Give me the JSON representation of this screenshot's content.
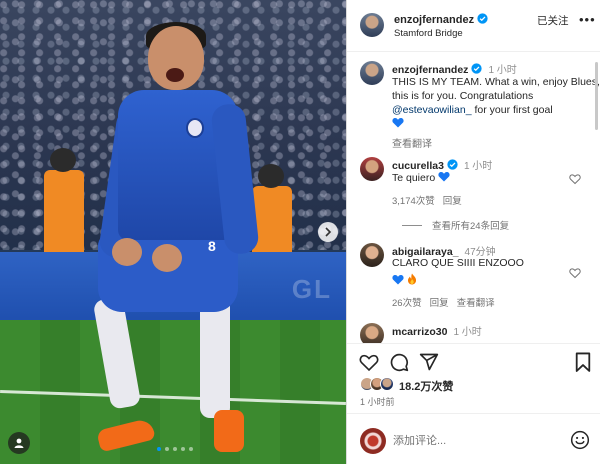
{
  "post": {
    "author": "enzojfernandez",
    "location": "Stamford Bridge",
    "follow_status": "已关注",
    "more_label": "•••",
    "jersey_number": "8",
    "caption": {
      "time": "1 小时",
      "text_before": "THIS IS MY TEAM. What a win, enjoy Blues, this is for you. Congratulations ",
      "mention": "@estevaowilian_",
      "text_after": " for your first goal",
      "see_translation": "查看翻译"
    },
    "likes": "18.2万次赞",
    "posted_ago": "1 小时前",
    "add_comment_placeholder": "添加评论..."
  },
  "comments": [
    {
      "user": "cucurella3",
      "time": "1 小时",
      "text": "Te quiero",
      "likes": "3,174次赞",
      "reply": "回复",
      "view_replies": "查看所有24条回复"
    },
    {
      "user": "abigailaraya_",
      "time": "47分钟",
      "text": "CLARO QUE SIIII ENZOOO",
      "likes": "26次赞",
      "reply": "回复",
      "see_translation": "查看翻译"
    },
    {
      "user": "mcarrizo30",
      "time": "1 小时"
    }
  ],
  "icons": {
    "like": "heart-icon",
    "comment": "comment-icon",
    "share": "share-icon",
    "save": "bookmark-icon",
    "emoji": "smiley-icon",
    "verified": "verified-badge-icon",
    "next": "chevron-right-icon",
    "tags": "user-tag-icon"
  },
  "colors": {
    "verified": "#0095f6",
    "mention": "#00376b",
    "blue_heart": "#1877f2",
    "muted": "#737373",
    "divider": "#dbdbdb"
  },
  "carousel": {
    "count": 5,
    "active_index": 0
  }
}
